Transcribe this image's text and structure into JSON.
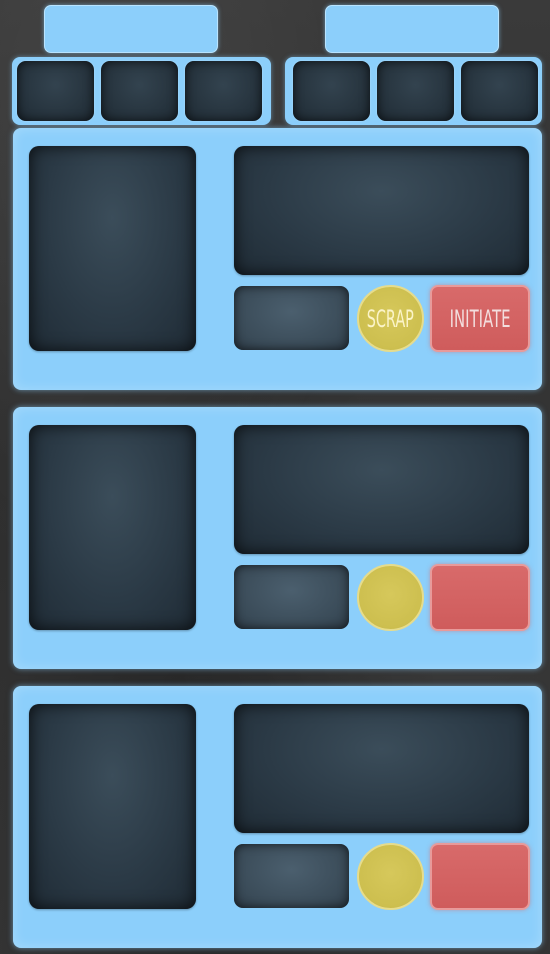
{
  "colors": {
    "panel_blue": "#8ccffb",
    "slot_dark": "#25323c",
    "scrap_yellow": "#cdbf4f",
    "initiate_red": "#cf5c5c",
    "background": "#333333"
  },
  "top_trays": [
    {
      "slots": 3
    },
    {
      "slots": 3
    }
  ],
  "panels": [
    {
      "scrap_label": "SCRAP",
      "initiate_label": "INITIATE"
    },
    {
      "scrap_label": "",
      "initiate_label": ""
    },
    {
      "scrap_label": "",
      "initiate_label": ""
    }
  ]
}
